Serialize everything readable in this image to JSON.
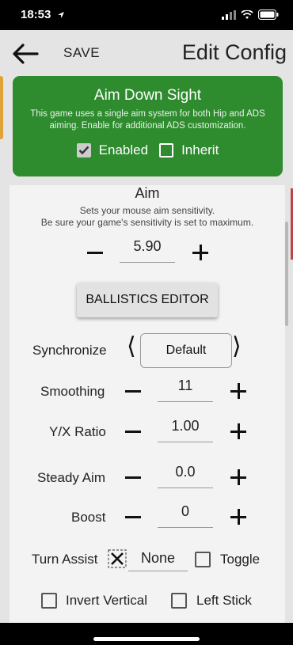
{
  "status_bar": {
    "time": "18:53"
  },
  "header": {
    "save_label": "SAVE",
    "title": "Edit Config"
  },
  "ads": {
    "title": "Aim Down Sight",
    "description": "This game uses a single aim system for both Hip and ADS aiming. Enable for additional ADS customization.",
    "enabled_label": "Enabled",
    "enabled_checked": true,
    "inherit_label": "Inherit",
    "inherit_checked": false,
    "color": "#2e8b2e"
  },
  "aim": {
    "title": "Aim",
    "desc_line1": "Sets your mouse aim sensitivity.",
    "desc_line2": "Be sure your game's sensitivity is set to maximum.",
    "value": "5.90"
  },
  "ballistics_label": "BALLISTICS EDITOR",
  "synchronize": {
    "label": "Synchronize",
    "value": "Default"
  },
  "smoothing": {
    "label": "Smoothing",
    "value": "11"
  },
  "yx_ratio": {
    "label": "Y/X Ratio",
    "value": "1.00"
  },
  "steady_aim": {
    "label": "Steady Aim",
    "value": "0.0"
  },
  "boost": {
    "label": "Boost",
    "value": "0"
  },
  "turn_assist": {
    "label": "Turn Assist",
    "value": "None",
    "toggle_label": "Toggle"
  },
  "invert_vertical_label": "Invert Vertical",
  "left_stick_label": "Left Stick"
}
